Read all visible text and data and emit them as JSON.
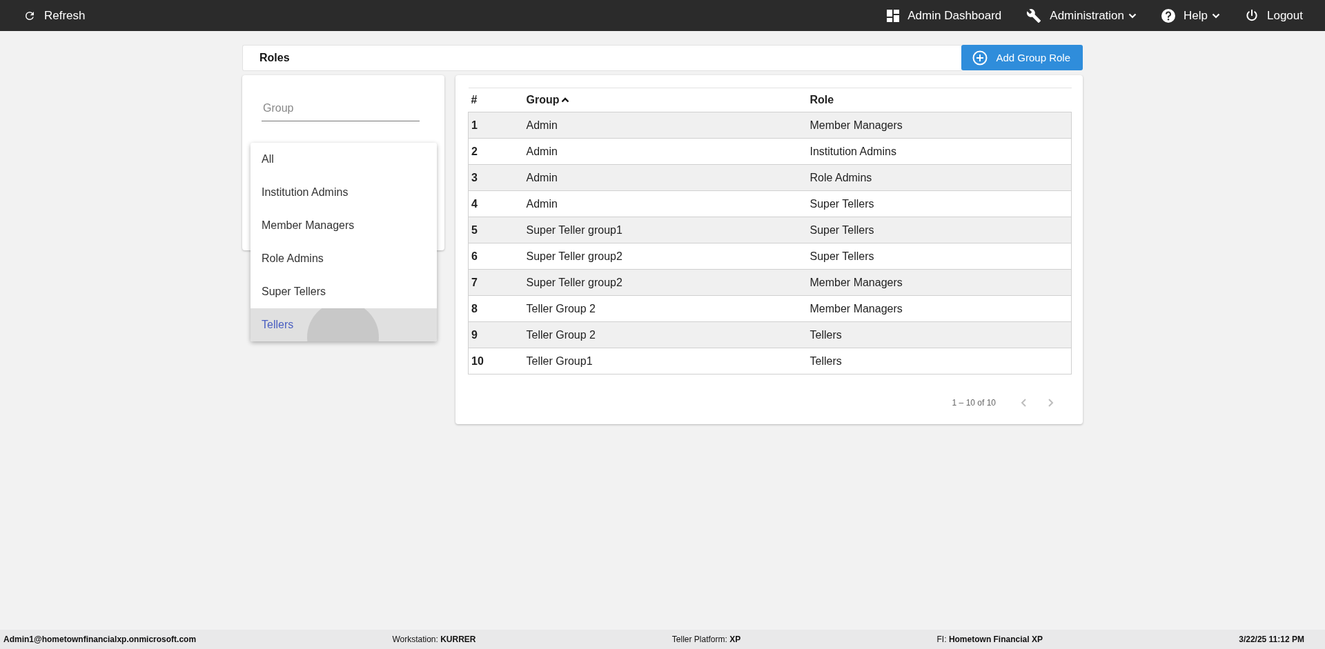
{
  "top_bar": {
    "left": {
      "kind": "refresh",
      "label": "Refresh"
    },
    "right": [
      {
        "kind": "dashboard",
        "label": "Admin Dashboard",
        "dropdown": false
      },
      {
        "kind": "wrench",
        "label": "Administration",
        "dropdown": true
      },
      {
        "kind": "help",
        "label": "Help",
        "dropdown": true
      },
      {
        "kind": "power",
        "label": "Logout",
        "dropdown": false
      }
    ]
  },
  "header": {
    "title": "Roles",
    "add_button": "Add Group Role"
  },
  "filter": {
    "group_field": {
      "placeholder": "Group"
    },
    "role_menu": [
      {
        "label": "All",
        "selected": false
      },
      {
        "label": "Institution Admins",
        "selected": false
      },
      {
        "label": "Member Managers",
        "selected": false
      },
      {
        "label": "Role Admins",
        "selected": false
      },
      {
        "label": "Super Tellers",
        "selected": false
      },
      {
        "label": "Tellers",
        "selected": true
      }
    ]
  },
  "table": {
    "columns": [
      {
        "label": "#",
        "sorted": false
      },
      {
        "label": "Group",
        "sorted": true
      },
      {
        "label": "Role",
        "sorted": false
      }
    ],
    "rows": [
      [
        "1",
        "Admin",
        "Member Managers"
      ],
      [
        "2",
        "Admin",
        "Institution Admins"
      ],
      [
        "3",
        "Admin",
        "Role Admins"
      ],
      [
        "4",
        "Admin",
        "Super Tellers"
      ],
      [
        "5",
        "Super Teller group1",
        "Super Tellers"
      ],
      [
        "6",
        "Super Teller group2",
        "Super Tellers"
      ],
      [
        "7",
        "Super Teller group2",
        "Member Managers"
      ],
      [
        "8",
        "Teller Group 2",
        "Member Managers"
      ],
      [
        "9",
        "Teller Group 2",
        "Tellers"
      ],
      [
        "10",
        "Teller Group1",
        "Tellers"
      ]
    ],
    "pagination": {
      "range": "1 – 10 of 10",
      "prev_disabled": true,
      "next_disabled": true
    }
  },
  "status_bar": {
    "user": "Admin1@hometownfinancialxp.onmicrosoft.com",
    "fields": [
      {
        "label": "Workstation:",
        "value": "KURRER"
      },
      {
        "label": "Teller Platform:",
        "value": "XP"
      },
      {
        "label": "FI:",
        "value": "Hometown Financial XP"
      }
    ],
    "datetime": "3/22/25 11:12 PM"
  }
}
